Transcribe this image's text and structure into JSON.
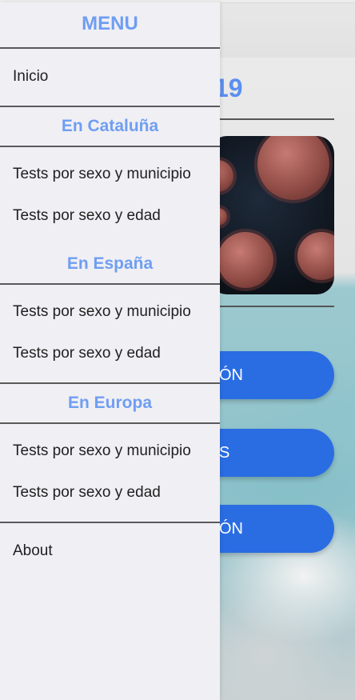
{
  "background": {
    "heading": "19",
    "buttons": [
      {
        "label": "ÓN"
      },
      {
        "label": "S"
      },
      {
        "label": "ÓN"
      }
    ]
  },
  "drawer": {
    "title": "MENU",
    "home_label": "Inicio",
    "sections": [
      {
        "heading": "En Cataluña",
        "links": [
          "Tests por sexo y municipio",
          "Tests por sexo y edad"
        ]
      },
      {
        "heading": "En España",
        "links": [
          "Tests por sexo y municipio",
          "Tests por sexo y edad"
        ]
      },
      {
        "heading": "En Europa",
        "links": [
          "Tests por sexo y municipio",
          "Tests por sexo y edad"
        ]
      }
    ],
    "about_label": "About"
  },
  "colors": {
    "accent": "#6f9ef2",
    "button": "#2a6de3",
    "drawer_bg": "#f0eff4",
    "divider": "#5a5a5a"
  }
}
